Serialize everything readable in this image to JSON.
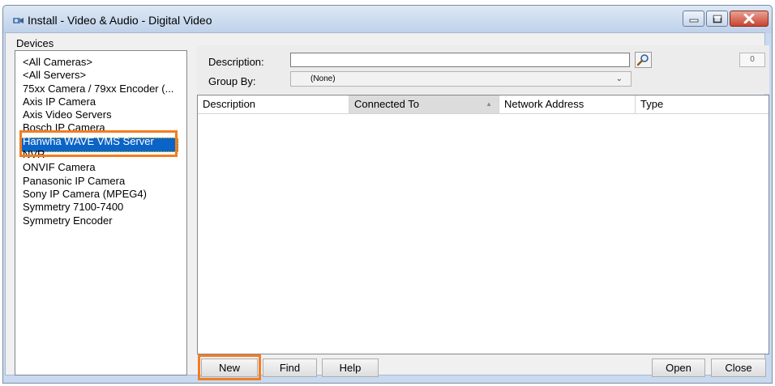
{
  "window": {
    "title": "Install - Video & Audio - Digital Video"
  },
  "devices": {
    "label": "Devices",
    "items": [
      "<All Cameras>",
      "<All Servers>",
      "75xx Camera / 79xx Encoder (...",
      "Axis IP Camera",
      "Axis Video Servers",
      "Bosch IP Camera",
      "Hanwha WAVE VMS Server",
      "NVR",
      "ONVIF Camera",
      "Panasonic IP Camera",
      "Sony IP Camera (MPEG4)",
      "Symmetry 7100-7400",
      "Symmetry Encoder"
    ],
    "selected": "Hanwha WAVE VMS Server"
  },
  "filter": {
    "description_label": "Description:",
    "description_value": "",
    "count": "0",
    "groupby_label": "Group By:",
    "groupby_value": "(None)"
  },
  "grid": {
    "columns": [
      "Description",
      "Connected To",
      "Network Address",
      "Type"
    ],
    "sorted_column": "Connected To",
    "rows": []
  },
  "buttons": {
    "new": "New",
    "find": "Find",
    "help": "Help",
    "open": "Open",
    "close": "Close"
  },
  "colors": {
    "highlight": "#f47c20",
    "selection": "#0a64c8"
  },
  "icons": {
    "app": "camera-install-icon",
    "search": "search-icon"
  }
}
